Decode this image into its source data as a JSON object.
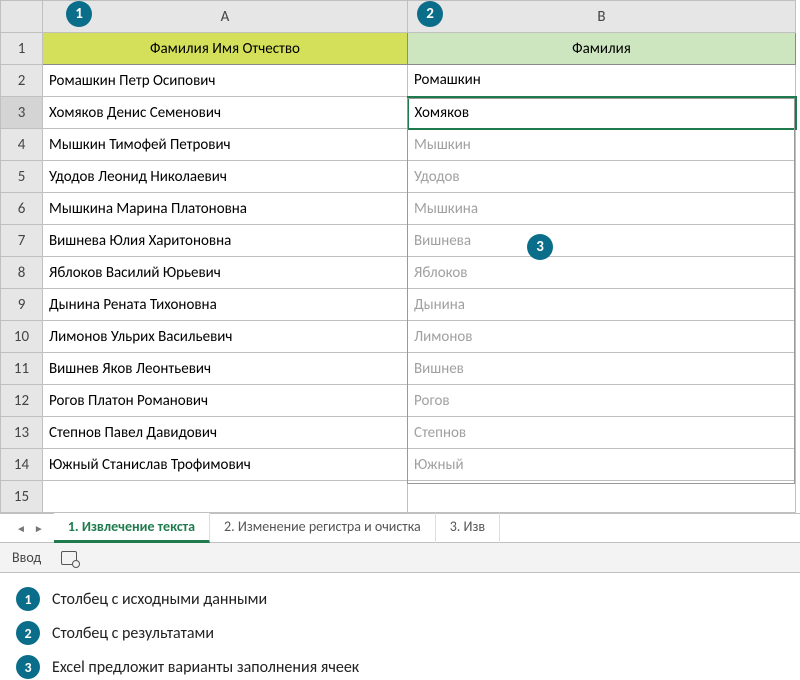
{
  "columns": {
    "A": "A",
    "B": "B"
  },
  "headers": {
    "A": "Фамилия Имя Отчество",
    "B": "Фамилия"
  },
  "rows": [
    {
      "n": 1
    },
    {
      "n": 2,
      "a": "Ромашкин Петр Осипович",
      "b": "Ромашкин",
      "committed": true
    },
    {
      "n": 3,
      "a": "Хомяков Денис Семенович",
      "b": "Хомяков",
      "committed": true,
      "active": true
    },
    {
      "n": 4,
      "a": "Мышкин Тимофей Петрович",
      "b": "Мышкин"
    },
    {
      "n": 5,
      "a": "Удодов Леонид Николаевич",
      "b": "Удодов"
    },
    {
      "n": 6,
      "a": "Мышкина Марина Платоновна",
      "b": "Мышкина"
    },
    {
      "n": 7,
      "a": "Вишнева Юлия Харитоновна",
      "b": "Вишнева"
    },
    {
      "n": 8,
      "a": "Яблоков Василий Юрьевич",
      "b": "Яблоков"
    },
    {
      "n": 9,
      "a": "Дынина Рената Тихоновна",
      "b": "Дынина"
    },
    {
      "n": 10,
      "a": "Лимонов Ульрих Васильевич",
      "b": "Лимонов"
    },
    {
      "n": 11,
      "a": "Вишнев Яков Леонтьевич",
      "b": "Вишнев"
    },
    {
      "n": 12,
      "a": "Рогов Платон Романович",
      "b": "Рогов"
    },
    {
      "n": 13,
      "a": "Степнов Павел Давидович",
      "b": "Степнов"
    },
    {
      "n": 14,
      "a": "Южный Станислав Трофимович",
      "b": "Южный"
    },
    {
      "n": 15,
      "a": "",
      "b": ""
    }
  ],
  "tabs": [
    {
      "label": "1. Извлечение текста",
      "active": true
    },
    {
      "label": "2. Изменение регистра и очистка"
    },
    {
      "label": "3. Изв"
    }
  ],
  "status": {
    "mode": "Ввод"
  },
  "callouts": {
    "1": "Столбец с исходными данными",
    "2": "Столбец с результатами",
    "3": "Excel предложит варианты заполнения ячеек"
  }
}
